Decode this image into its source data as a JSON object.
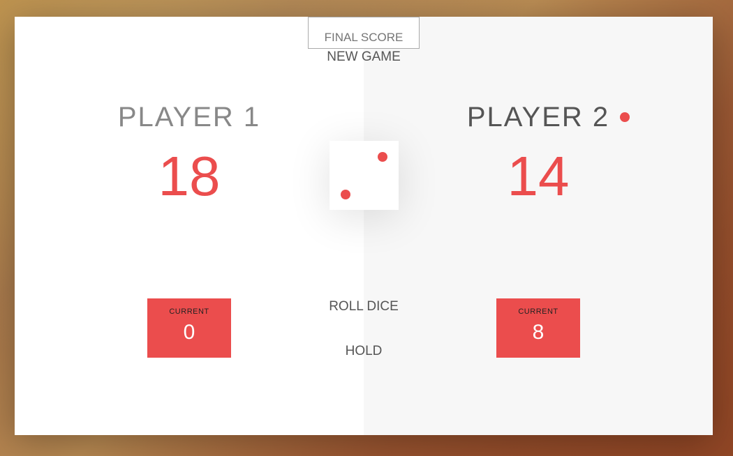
{
  "game": {
    "final_score_placeholder": "FINAL SCORE",
    "new_game_label": "NEW GAME",
    "roll_dice_label": "ROLL DICE",
    "hold_label": "HOLD",
    "dice_value": 2,
    "active_player": 2
  },
  "players": [
    {
      "name": "PLAYER 1",
      "score": "18",
      "current_label": "CURRENT",
      "current_score": "0"
    },
    {
      "name": "PLAYER 2",
      "score": "14",
      "current_label": "CURRENT",
      "current_score": "8"
    }
  ],
  "colors": {
    "accent": "#EB4D4D",
    "panel_active": "#f7f7f7",
    "panel_inactive": "#ffffff"
  }
}
